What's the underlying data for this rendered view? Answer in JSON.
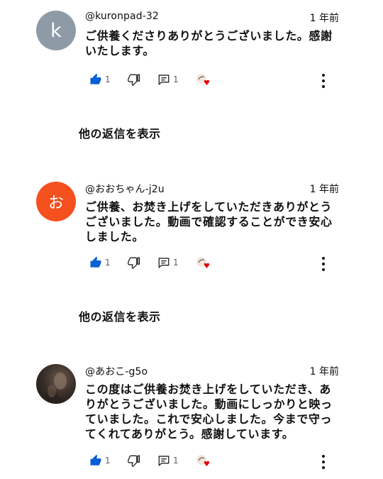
{
  "comments": [
    {
      "handle": "@kuronpad-32",
      "time": "1 年前",
      "avatar_letter": "k",
      "avatar_color": "#8e9ba6",
      "lines": [
        "ご供養くださりありがとうございました。感謝",
        "いたします。"
      ],
      "likes": "1",
      "replies_count": "1",
      "show_replies": "他の返信を表示"
    },
    {
      "handle": "@おおちゃん-j2u",
      "time": "1 年前",
      "avatar_letter": "お",
      "avatar_color": "#f4511e",
      "lines": [
        "ご供養、お焚き上げをしていただきありがとう",
        "ございました。動画で確認することができ安心",
        "しました。"
      ],
      "likes": "1",
      "replies_count": "1",
      "show_replies": "他の返信を表示"
    },
    {
      "handle": "@あおこ-g5o",
      "time": "1 年前",
      "lines": [
        "この度はご供養お焚き上げをしていただき、あ",
        "りがとうございました。動画にしっかりと映っ",
        "ていました。これで安心しました。今まで守っ",
        "てくれてありがとう。感謝しています。"
      ],
      "likes": "1",
      "replies_count": "1"
    }
  ],
  "icons": {
    "like": "thumb-up-icon",
    "dislike": "thumb-down-icon",
    "reply": "comment-icon",
    "creator_heart": "creator-heart-icon",
    "more": "more-vert-icon"
  },
  "colors": {
    "like_blue": "#065fd4",
    "heart_red": "#e00000"
  }
}
